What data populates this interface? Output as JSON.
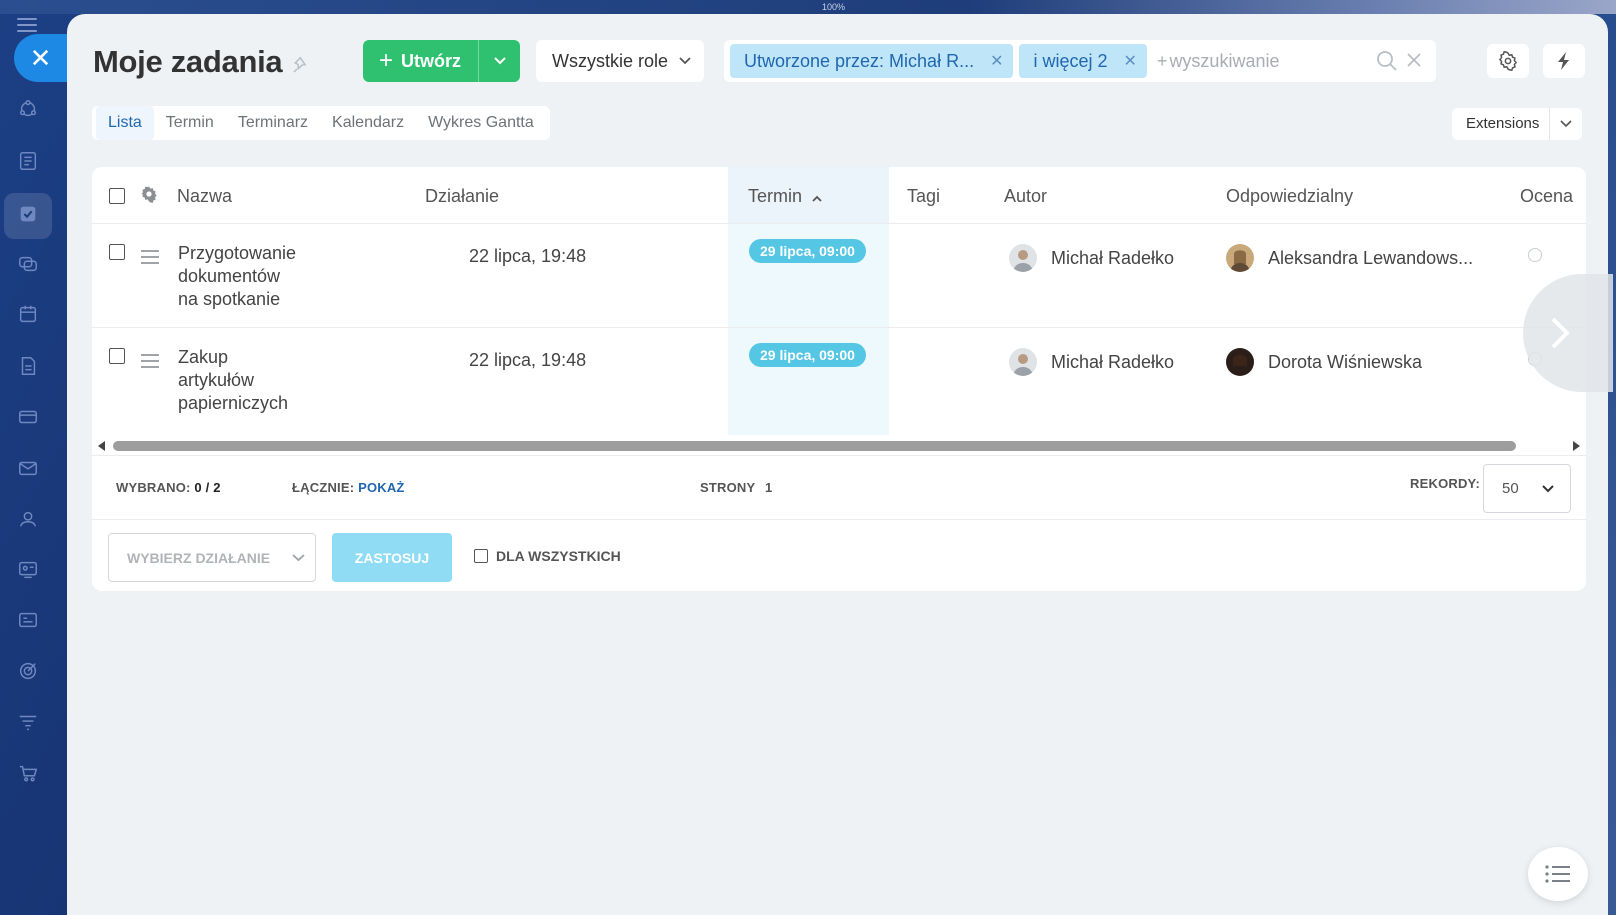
{
  "window": {
    "zoom": "100%"
  },
  "header": {
    "title": "Moje zadania",
    "create_label": "Utwórz",
    "roles_label": "Wszystkie role",
    "filter_chips": [
      "Utworzone przez: Michał R...",
      "i więcej 2"
    ],
    "search_plus": "+",
    "search_placeholder": "wyszukiwanie"
  },
  "tabs": [
    "Lista",
    "Termin",
    "Terminarz",
    "Kalendarz",
    "Wykres Gantta"
  ],
  "active_tab": "Lista",
  "extensions_label": "Extensions",
  "grid": {
    "columns": [
      "Nazwa",
      "Działanie",
      "Termin",
      "Tagi",
      "Autor",
      "Odpowiedzialny",
      "Ocena"
    ],
    "sort_column": "Termin",
    "sort_direction": "asc",
    "rows": [
      {
        "name": [
          "Przygotowanie",
          "dokumentów",
          "na spotkanie"
        ],
        "activity": "22 lipca, 19:48",
        "deadline": "29 lipca, 09:00",
        "author": "Michał Radełko",
        "responsible": "Aleksandra Lewandows..."
      },
      {
        "name": [
          "Zakup",
          "artykułów",
          "papierniczych"
        ],
        "activity": "22 lipca, 19:48",
        "deadline": "29 lipca, 09:00",
        "author": "Michał Radełko",
        "responsible": "Dorota Wiśniewska"
      }
    ]
  },
  "footer": {
    "selected_label": "WYBRANO:",
    "selected_value": "0 / 2",
    "total_label": "ŁĄCZNIE:",
    "total_link": "POKAŻ",
    "pages_label": "STRONY",
    "pages_value": "1",
    "records_label": "REKORDY:",
    "records_value": "50"
  },
  "actions": {
    "select_placeholder": "WYBIERZ DZIAŁANIE",
    "apply_label": "ZASTOSUJ",
    "for_all_label": "DLA WSZYSTKICH"
  },
  "colors": {
    "accent_blue": "#1e88e5",
    "create_green": "#2fc16f",
    "deadline_badge": "#55c7e5",
    "apply_disabled": "#8fdcf4"
  },
  "icons": {
    "rail": [
      "hamburger-icon",
      "close-icon",
      "crm-icon",
      "feed-icon",
      "tasks-icon",
      "chat-icon",
      "calendar-icon",
      "docs-icon",
      "card-icon",
      "mail-icon",
      "contacts-icon",
      "webinar-icon",
      "forms-icon",
      "target-icon",
      "funnel-icon",
      "cart-icon"
    ]
  }
}
